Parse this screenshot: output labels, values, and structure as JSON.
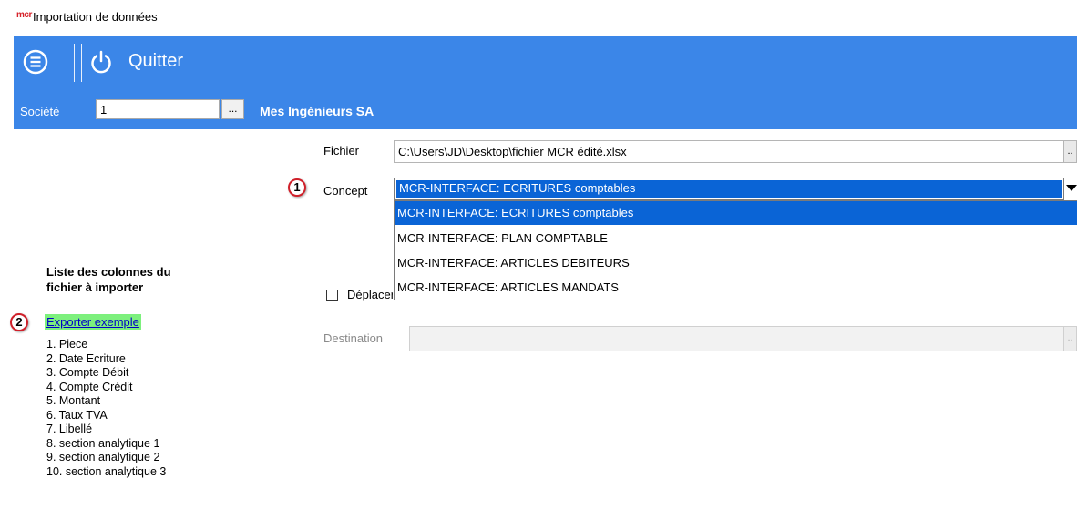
{
  "window": {
    "app_logo": "mcr",
    "title": "Importation de données"
  },
  "toolbar": {
    "menu_icon": "menu-circle-icon",
    "power_icon": "power-icon",
    "quit_label": "Quitter"
  },
  "company": {
    "label": "Société",
    "value": "1",
    "browse_label": "...",
    "name": "Mes Ingénieurs SA"
  },
  "form": {
    "file_label": "Fichier",
    "file_value": "C:\\Users\\JD\\Desktop\\fichier MCR édité.xlsx",
    "file_browse_label": "..",
    "concept_label": "Concept",
    "concept_selected": "MCR-INTERFACE: ECRITURES comptables",
    "concept_options": [
      "MCR-INTERFACE: ECRITURES comptables",
      "MCR-INTERFACE: PLAN COMPTABLE",
      "MCR-INTERFACE: ARTICLES DEBITEURS",
      "MCR-INTERFACE: ARTICLES MANDATS"
    ],
    "move_checkbox_label": "Déplacer",
    "destination_label": "Destination",
    "destination_value": "",
    "destination_browse_label": ".."
  },
  "badges": {
    "concept": "1",
    "export": "2"
  },
  "columns_panel": {
    "title_line1": "Liste des colonnes du",
    "title_line2": "fichier à importer",
    "export_link": "Exporter exemple",
    "columns": [
      "1.  Piece",
      "2.  Date Ecriture",
      "3.  Compte Débit",
      "4.  Compte Crédit",
      "5.  Montant",
      "6.  Taux TVA",
      "7.  Libellé",
      "8.  section analytique 1",
      "9.  section analytique 2",
      "10.  section analytique 3"
    ]
  },
  "colors": {
    "toolbar_blue": "#3b86e8",
    "selection_blue": "#0a64d6",
    "badge_red": "#d0202a",
    "link_highlight": "#7df07d"
  }
}
